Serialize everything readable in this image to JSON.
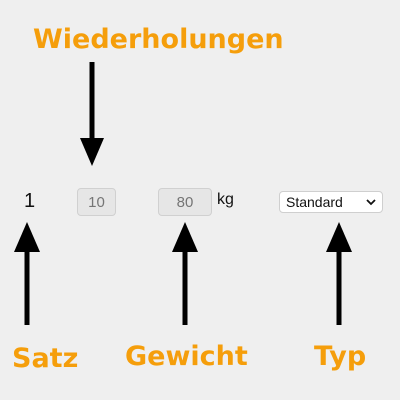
{
  "callouts": {
    "reps": "Wiederholungen",
    "set": "Satz",
    "weight": "Gewicht",
    "type": "Typ"
  },
  "row": {
    "set_number": "1",
    "reps_value": "10",
    "weight_value": "80",
    "weight_unit": "kg",
    "type_selected": "Standard"
  },
  "colors": {
    "callout": "#f59e0b",
    "arrow": "#000000",
    "background": "#efefef"
  }
}
